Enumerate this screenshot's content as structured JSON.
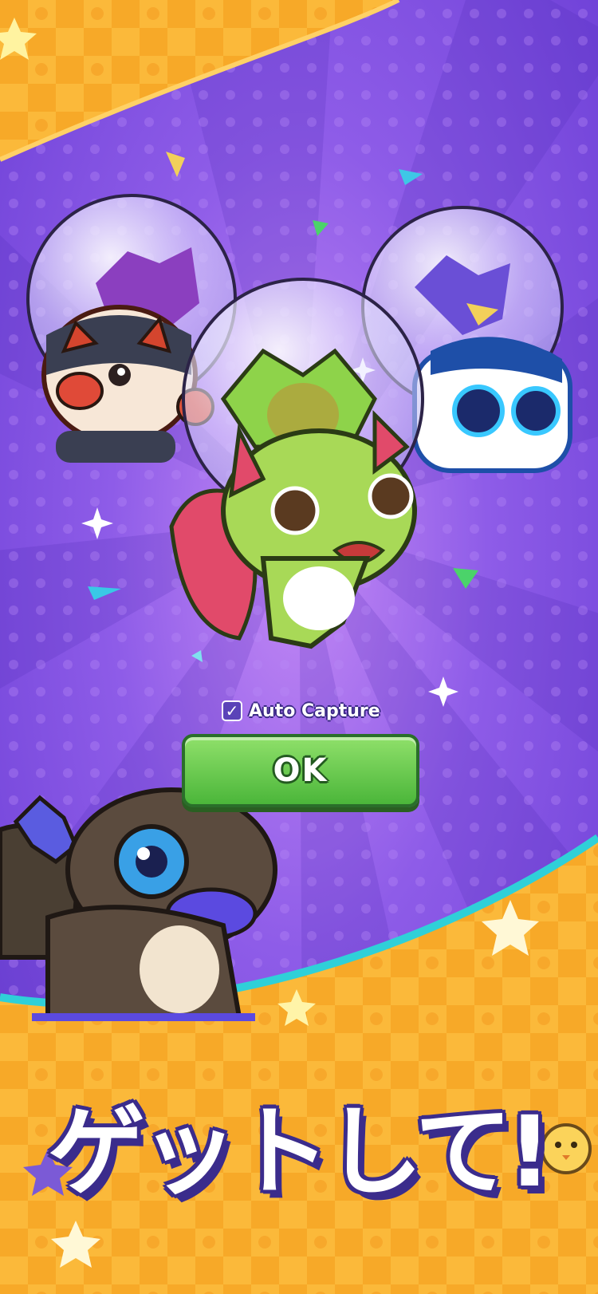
{
  "dialog": {
    "auto_capture_label": "Auto Capture",
    "auto_capture_checked": true,
    "ok_label": "OK"
  },
  "promo": {
    "headline": "ゲットして!"
  },
  "colors": {
    "background_purple": "#7d4fe0",
    "banner_orange": "#f9b233",
    "button_green": "#5cc447",
    "accent_teal": "#2fd0d8"
  },
  "creatures": [
    "fox-dog-creature",
    "green-cat-creature",
    "blue-robot-cat-creature",
    "brown-lizard-creature",
    "chick-creature"
  ]
}
